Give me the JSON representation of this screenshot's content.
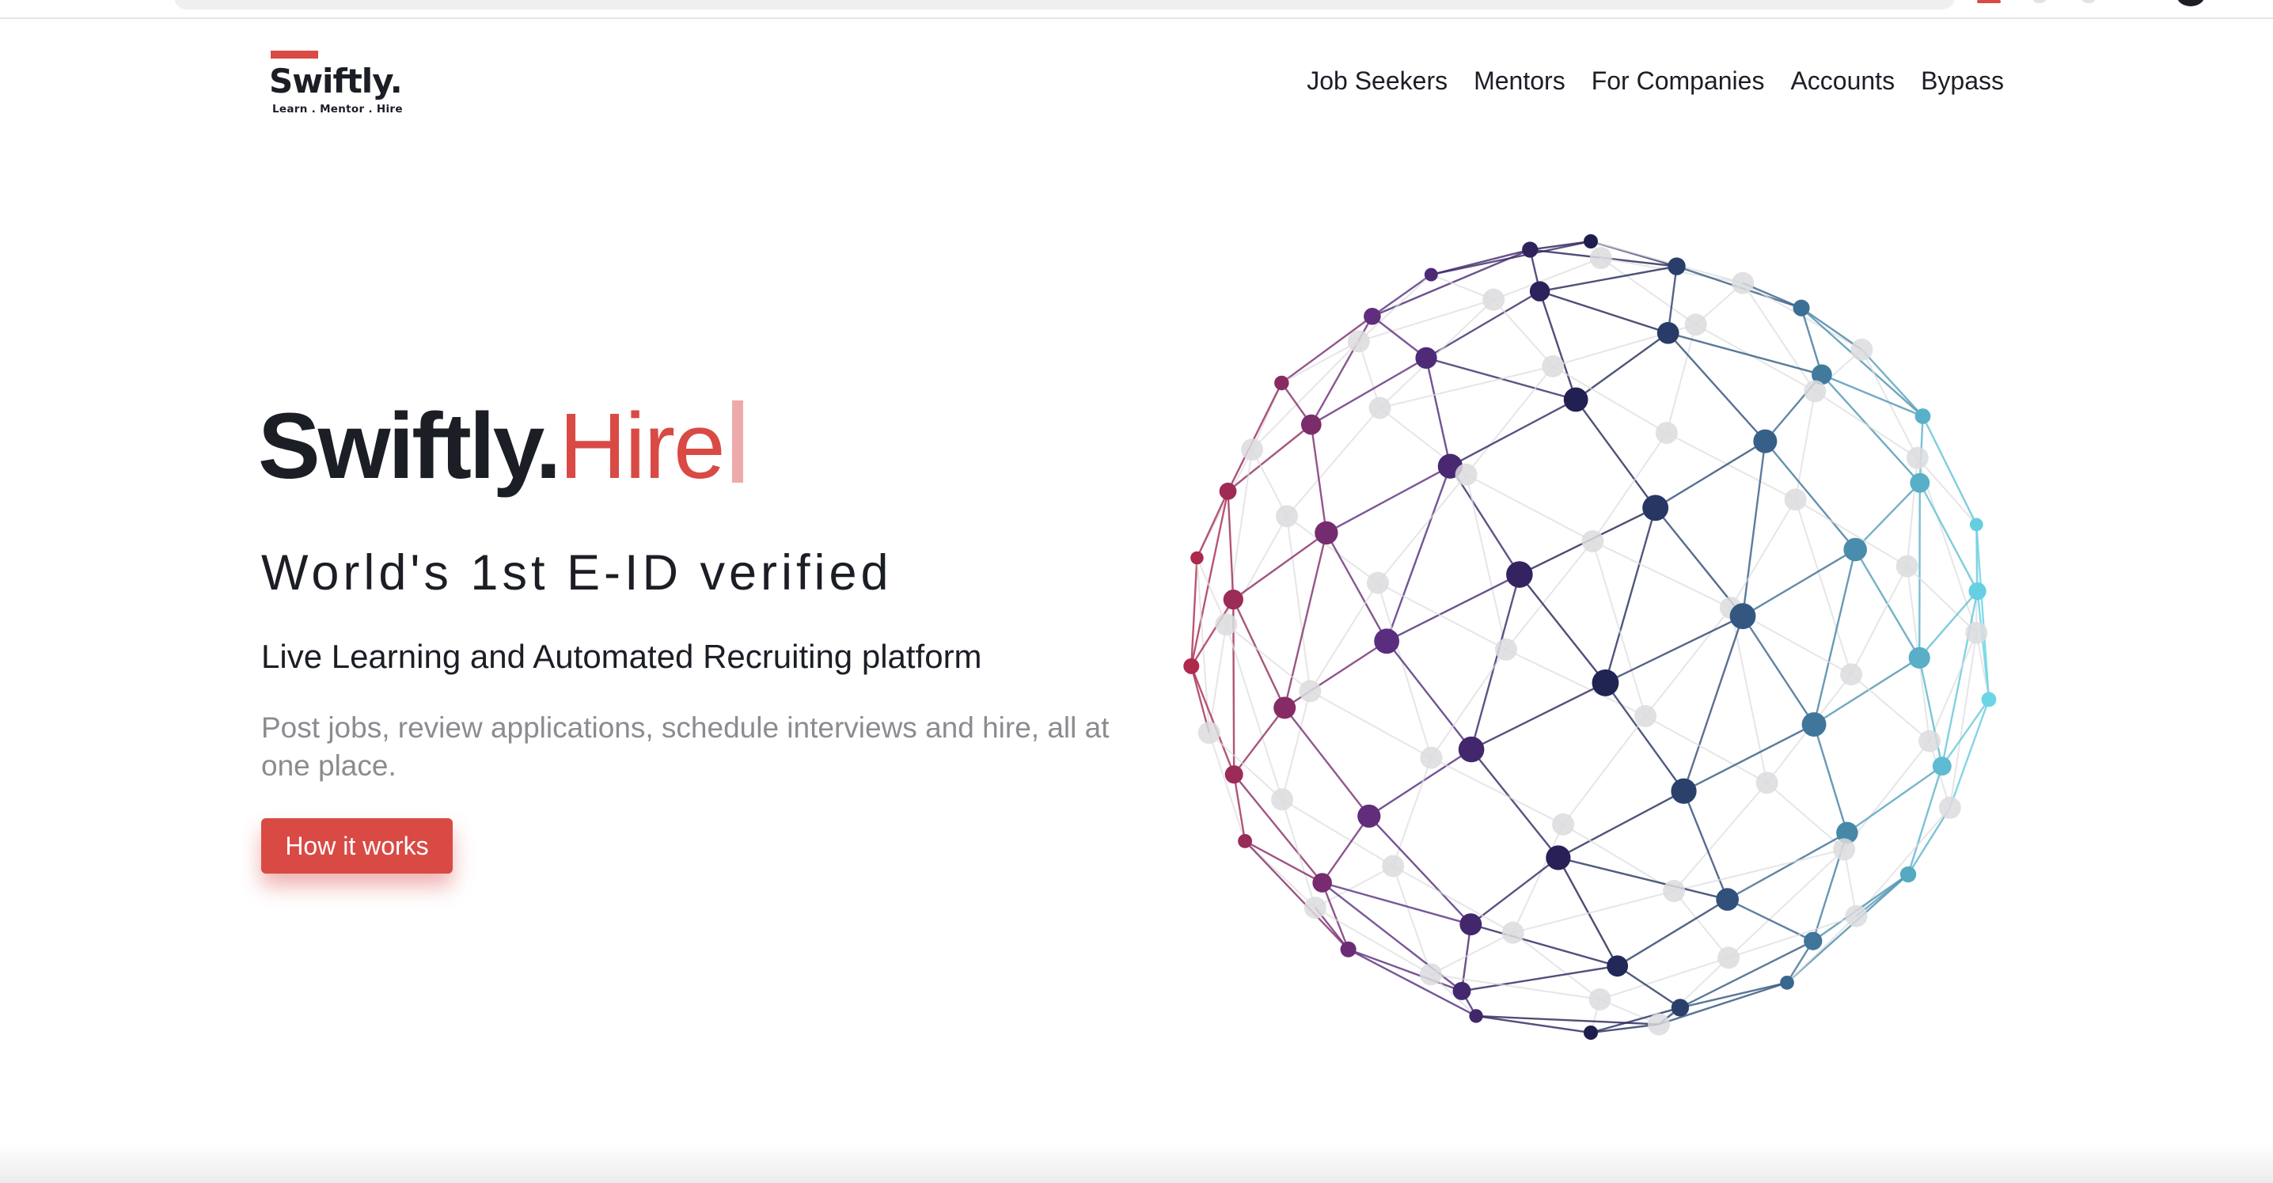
{
  "brand": {
    "name": "Swiftly.",
    "tagline": "Learn . Mentor . Hire",
    "accent_color": "#d94a45",
    "text_color": "#1c1e26"
  },
  "nav": {
    "items": [
      {
        "label": "Job Seekers"
      },
      {
        "label": "Mentors"
      },
      {
        "label": "For Companies"
      },
      {
        "label": "Accounts"
      },
      {
        "label": "Bypass"
      }
    ]
  },
  "hero": {
    "title_brand": "Swiftly.",
    "title_accent": "Hire",
    "subtitle": "World's 1st E-ID verified",
    "tagline": "Live Learning and Automated Recruiting platform",
    "description": "Post jobs, review applications, schedule interviews and hire, all at one place.",
    "cta_label": "How it works"
  },
  "illustration": {
    "type": "network-globe",
    "gradient_colors": [
      "#b02a4a",
      "#5a2d80",
      "#1e1e4e",
      "#3a6a90",
      "#6ad8e8"
    ]
  }
}
